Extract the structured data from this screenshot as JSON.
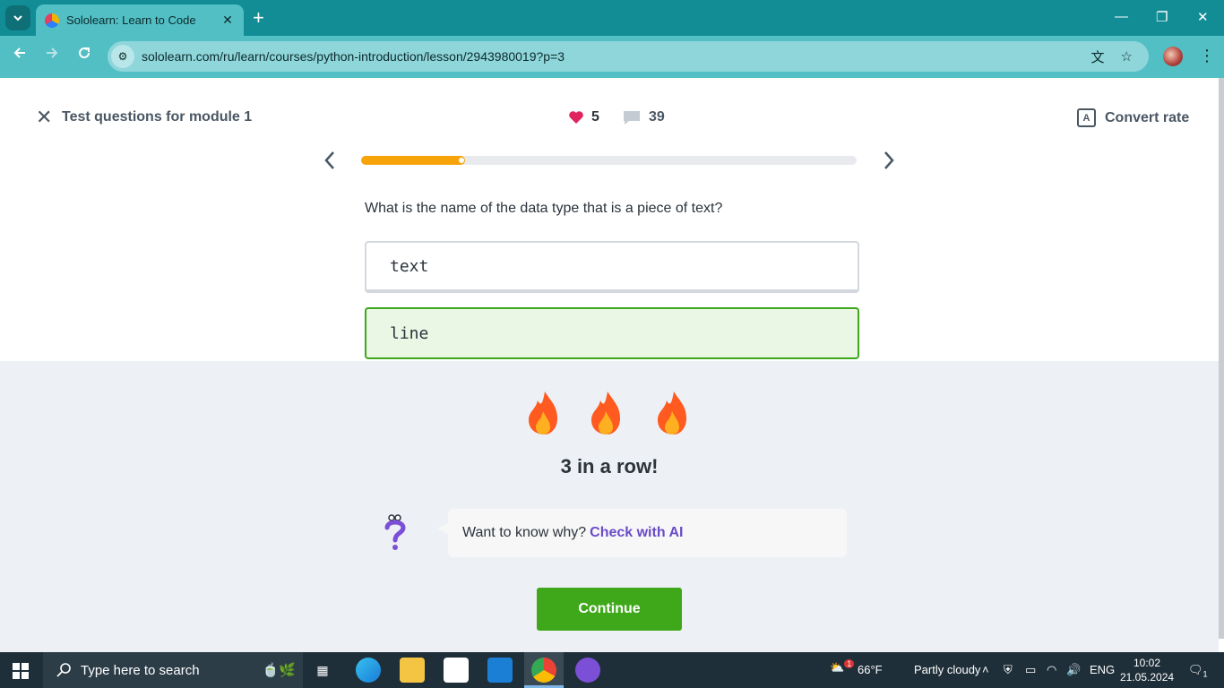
{
  "browser": {
    "tab_title": "Sololearn: Learn to Code",
    "url": "sololearn.com/ru/learn/courses/python-introduction/lesson/2943980019?p=3"
  },
  "header": {
    "title": "Test questions for module 1",
    "hearts": "5",
    "comments": "39",
    "convert_label": "Convert rate"
  },
  "progress": {
    "fraction": 0.21
  },
  "question": {
    "text": "What is the name of the data type that is a piece of text?",
    "options": [
      "text",
      "line"
    ]
  },
  "feedback": {
    "streak": "3 in a row!",
    "prompt": "Want to know why?",
    "ai_link": "Check with AI",
    "continue_label": "Continue"
  },
  "taskbar": {
    "search_placeholder": "Type here to search",
    "weather_temp": "66°F",
    "weather_text": "Partly cloudy",
    "weather_badge": "1",
    "language": "ENG",
    "time": "10:02",
    "date": "21.05.2024",
    "notif_count": "1"
  },
  "colors": {
    "browser_frame": "#128c95",
    "progress": "#f7a40a",
    "correct": "#3fa81a",
    "ai_link": "#6a4cc7",
    "heart": "#e0245e"
  }
}
